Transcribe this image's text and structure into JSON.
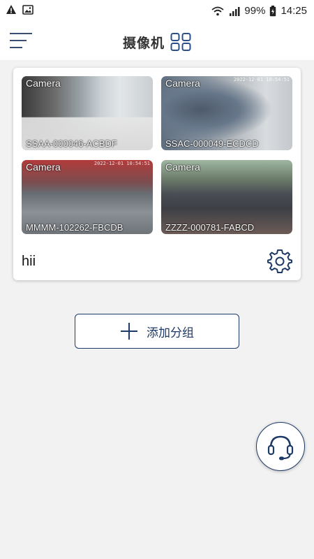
{
  "status_bar": {
    "battery": "99%",
    "time": "14:25",
    "icons": [
      "warning-icon",
      "image-icon",
      "wifi-icon",
      "signal-icon",
      "battery-icon"
    ]
  },
  "header": {
    "title": "摄像机",
    "menu_icon": "menu-icon",
    "view_icon": "grid-view-icon"
  },
  "group": {
    "name": "hii",
    "settings_icon": "gear-icon",
    "cameras": [
      {
        "label": "Camera",
        "device_id": "SSAA-000046-ACBDF",
        "stamp": ""
      },
      {
        "label": "Camera",
        "device_id": "SSAC-000049-ECDCD",
        "stamp": "2022-12-01 10:54:51"
      },
      {
        "label": "Camera",
        "device_id": "MMMM-102262-FBCDB",
        "stamp": "2022-12-01 10:54:51"
      },
      {
        "label": "Camera",
        "device_id": "ZZZZ-000781-FABCD",
        "stamp": ""
      }
    ]
  },
  "add_group": {
    "label": "添加分组",
    "icon": "plus-icon"
  },
  "support": {
    "icon": "headset-icon"
  },
  "colors": {
    "accent": "#1d3a66",
    "background": "#f2f2f3"
  }
}
